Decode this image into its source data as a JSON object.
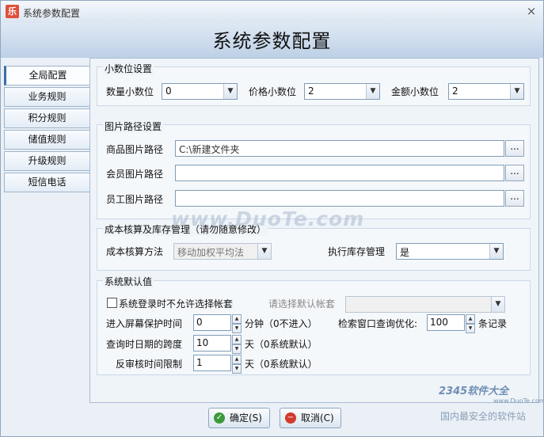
{
  "window": {
    "title": "系统参数配置",
    "close_glyph": "×",
    "app_icon_text": "乐"
  },
  "banner": {
    "title": "系统参数配置"
  },
  "tabs": [
    {
      "label": "全局配置"
    },
    {
      "label": "业务规则"
    },
    {
      "label": "积分规则"
    },
    {
      "label": "储值规则"
    },
    {
      "label": "升级规则"
    },
    {
      "label": "短信电话"
    }
  ],
  "decimal": {
    "title": "小数位设置",
    "qty_label": "数量小数位",
    "qty_value": "0",
    "price_label": "价格小数位",
    "price_value": "2",
    "amount_label": "金额小数位",
    "amount_value": "2"
  },
  "image_path": {
    "title": "图片路径设置",
    "product_label": "商品图片路径",
    "product_value": "C:\\新建文件夹",
    "member_label": "会员图片路径",
    "member_value": "",
    "staff_label": "员工图片路径",
    "staff_value": "",
    "browse_label": "..."
  },
  "cost": {
    "title": "成本核算及库存管理（请勿随意修改）",
    "method_label": "成本核算方法",
    "method_value": "移动加权平均法",
    "stock_label": "执行库存管理",
    "stock_value": "是"
  },
  "defaults": {
    "title": "系统默认值",
    "login_checkbox_label": "系统登录时不允许选择帐套",
    "account_label": "请选择默认帐套",
    "account_value": "",
    "screensaver_label": "进入屏幕保护时间",
    "screensaver_value": "0",
    "screensaver_unit": "分钟（0不进入）",
    "query_opt_label": "检索窗口查询优化:",
    "query_opt_value": "100",
    "query_opt_unit": "条记录",
    "date_span_label": "查询时日期的跨度",
    "date_span_value": "10",
    "date_span_unit": "天（0系统默认）",
    "reverse_label": "反审核时间限制",
    "reverse_value": "1",
    "reverse_unit": "天（0系统默认）"
  },
  "buttons": {
    "ok": "确定(S)",
    "cancel": "取消(C)"
  },
  "watermarks": {
    "duote": "www.DuoTe.com",
    "logo": "2345软件大全",
    "logo_url": "www.DuoTe.com",
    "logo_sub": "国内最安全的软件站"
  }
}
